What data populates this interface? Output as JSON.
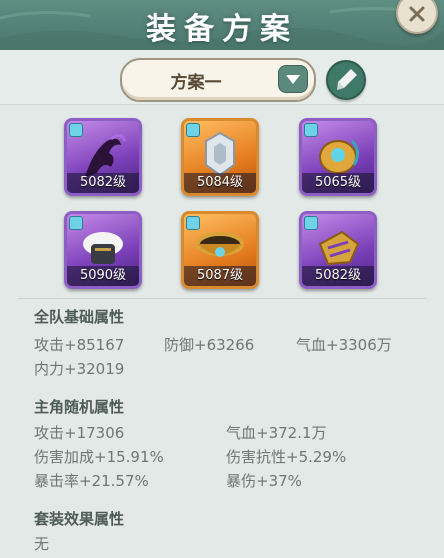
{
  "header": {
    "title": "装备方案"
  },
  "selector": {
    "label": "方案一"
  },
  "equipment": [
    {
      "level": "5082级",
      "rarity": "purple",
      "icon": "dark-weapon-icon"
    },
    {
      "level": "5084级",
      "rarity": "orange",
      "icon": "armor-helmet-icon"
    },
    {
      "level": "5065级",
      "rarity": "purple",
      "icon": "golden-orb-icon"
    },
    {
      "level": "5090级",
      "rarity": "purple",
      "icon": "fur-armor-icon"
    },
    {
      "level": "5087级",
      "rarity": "orange",
      "icon": "gold-belt-icon"
    },
    {
      "level": "5082级",
      "rarity": "purple",
      "icon": "gold-gauntlet-icon"
    }
  ],
  "team_stats": {
    "title": "全队基础属性",
    "attack": "攻击+85167",
    "defense": "防御+63266",
    "hp": "气血+3306万",
    "inner_power": "内力+32019"
  },
  "hero_stats": {
    "title": "主角随机属性",
    "attack": "攻击+17306",
    "hp": "气血+372.1万",
    "damage_bonus": "伤害加成+15.91%",
    "damage_resist": "伤害抗性+5.29%",
    "crit_rate": "暴击率+21.57%",
    "crit_damage": "暴伤+37%"
  },
  "set_effect": {
    "title": "套装效果属性",
    "value": "无"
  },
  "colors": {
    "header": "#5f8e83",
    "purple_frame": "#8d5fc4",
    "orange_frame": "#d88a2e",
    "stat_text": "#6b7875",
    "section_title": "#4f5b58"
  }
}
